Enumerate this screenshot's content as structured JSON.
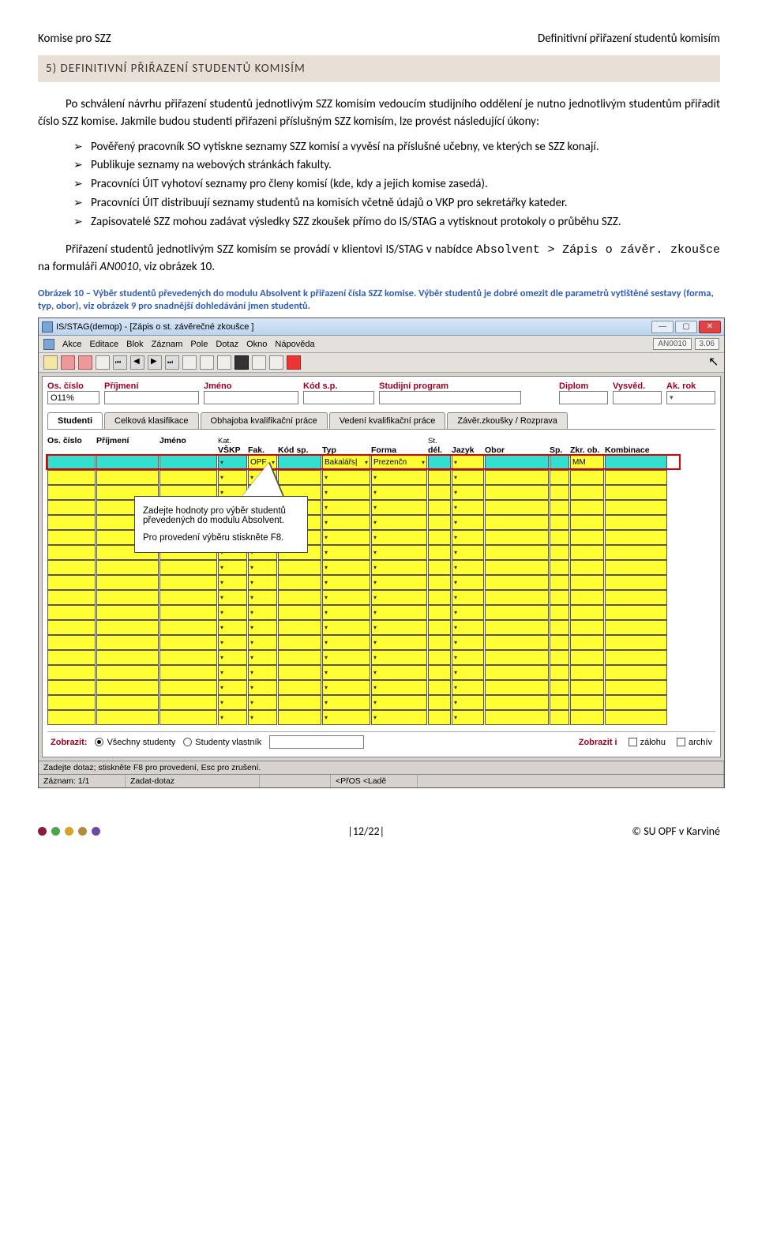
{
  "header": {
    "left": "Komise pro SZZ",
    "right": "Definitivní přiřazení studentů komisím"
  },
  "heading": "5)  DEFINITIVNÍ PŘIŘAZENÍ STUDENTŮ KOMISÍM",
  "para1": "Po schválení návrhu přiřazení studentů jednotlivým SZZ komisím vedoucím studijního oddělení je nutno jednotlivým studentům přiřadit číslo SZZ komise. Jakmile budou studenti přiřazeni příslušným SZZ komisím, lze provést následující úkony:",
  "bullets": [
    "Pověřený pracovník SO vytiskne seznamy SZZ komisí a vyvěsí na příslušné učebny, ve kterých se SZZ konají.",
    "Publikuje seznamy na webových stránkách fakulty.",
    "Pracovníci ÚIT vyhotoví seznamy pro členy komisí (kde, kdy a jejich komise zasedá).",
    "Pracovníci ÚIT distribuují seznamy studentů na komisích včetně údajů o VKP pro sekretářky kateder.",
    "Zapisovatelé SZZ mohou zadávat výsledky SZZ zkoušek přímo do IS/STAG a vytisknout protokoly o průběhu SZZ."
  ],
  "para2_pre": "Přiřazení studentů jednotlivým SZZ komisím se provádí v klientovi IS/STAG v nabídce ",
  "para2_code1": "Absolvent > Zápis o závěr. zkoušce",
  "para2_mid": " na formuláři ",
  "para2_form": "AN0010",
  "para2_post": ", viz obrázek 10.",
  "caption": "Obrázek 10 – Výběr studentů převedených do modulu Absolvent k přiřazení čísla SZZ komise. Výběr studentů je dobré omezit dle parametrů vytištěné sestavy (forma, typ, obor), viz obrázek 9 pro snadnější dohledávání jmen studentů.",
  "ss": {
    "title": "IS/STAG(demop) - [Zápis o st. závěrečné zkoušce ]",
    "menu": [
      "Akce",
      "Editace",
      "Blok",
      "Záznam",
      "Pole",
      "Dotaz",
      "Okno",
      "Nápověda"
    ],
    "code1": "AN0010",
    "code2": "3.06",
    "filter_labels": [
      "Os. číslo",
      "Příjmení",
      "Jméno",
      "Kód s.p.",
      "Studijní program",
      "Diplom",
      "Vysvěd.",
      "Ak. rok"
    ],
    "filter_values": {
      "os_cislo": "O11%"
    },
    "tabs": [
      "Studenti",
      "Celková klasifikace",
      "Obhajoba kvalifikační práce",
      "Vedení kvalifikační práce",
      "Závěr.zkoušky / Rozprava"
    ],
    "grid_headers": {
      "row1": [
        "Os. číslo",
        "Příjmení",
        "Jméno",
        "Kat.",
        "",
        "",
        "",
        "",
        "St.",
        "",
        "",
        "",
        "",
        ""
      ],
      "row_sub": [
        "",
        "",
        "",
        "VŠKP",
        "Fak.",
        "Kód sp.",
        "Typ",
        "Forma",
        "dél.",
        "Jazyk",
        "Obor",
        "Sp.",
        "Zkr. ob.",
        "Kombinace"
      ]
    },
    "first_row": {
      "fak": "OPF",
      "typ": "Bakalářs|",
      "forma": "Prezenčn",
      "zkr": "MM"
    },
    "tooltip_line1": "Zadejte hodnoty pro výběr studentů převedených do modulu Absolvent.",
    "tooltip_line2": "Pro provedení výběru stiskněte F8.",
    "bottom": {
      "label_left": "Zobrazit:",
      "opt_all": "Všechny studenty",
      "opt_own": "Studenty vlastník",
      "label_right": "Zobrazit i",
      "chk1": "zálohu",
      "chk2": "archív"
    },
    "status": {
      "msg": "Zadejte dotaz; stiskněte F8 pro provedení, Esc pro zrušení.",
      "rec": "Záznam: 1/1",
      "mode": "Zadat-dotaz",
      "flags": "<PřOS <Ladě"
    }
  },
  "footer": {
    "page": "|12/22|",
    "right": "© SU OPF v Karviné"
  },
  "dot_colors": [
    "#8a1a3a",
    "#4aa84a",
    "#d8a22a",
    "#b58a3a",
    "#6a4aa8"
  ]
}
